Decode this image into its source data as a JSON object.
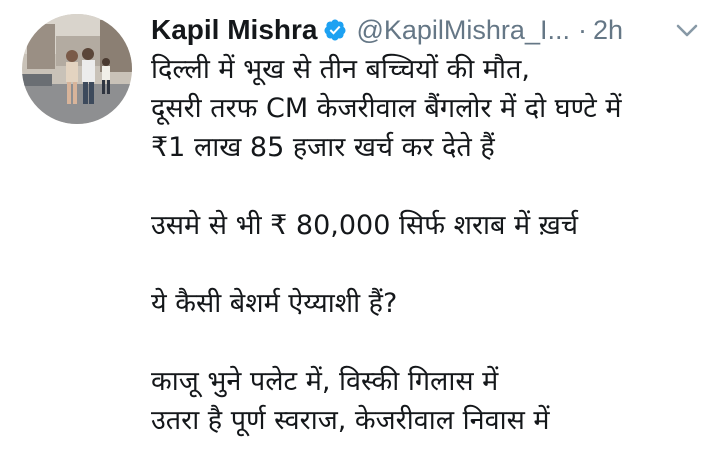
{
  "tweet": {
    "author_name": "Kapil Mishra",
    "handle": "@KapilMishra_I...",
    "separator": "·",
    "time": "2h",
    "lines": [
      "दिल्ली में भूख से तीन बच्चियों की मौत,",
      "दूसरी तरफ CM केजरीवाल बैंगलोर में दो घण्टे में",
      "₹1 लाख 85 हजार खर्च कर देते हैं",
      "उसमे से भी ₹ 80,000 सिर्फ शराब में ख़र्च",
      "ये कैसी बेशर्म ऐय्याशी हैं?",
      "काजू भुने पलेट में, विस्की गिलास में",
      "उतरा है पूर्ण स्वराज, केजरीवाल निवास में"
    ]
  },
  "icons": {
    "verified": "verified-badge-icon",
    "menu": "chevron-down-icon"
  },
  "colors": {
    "text": "#14171a",
    "secondary": "#657786",
    "verified": "#1da1f2",
    "background": "#ffffff"
  }
}
